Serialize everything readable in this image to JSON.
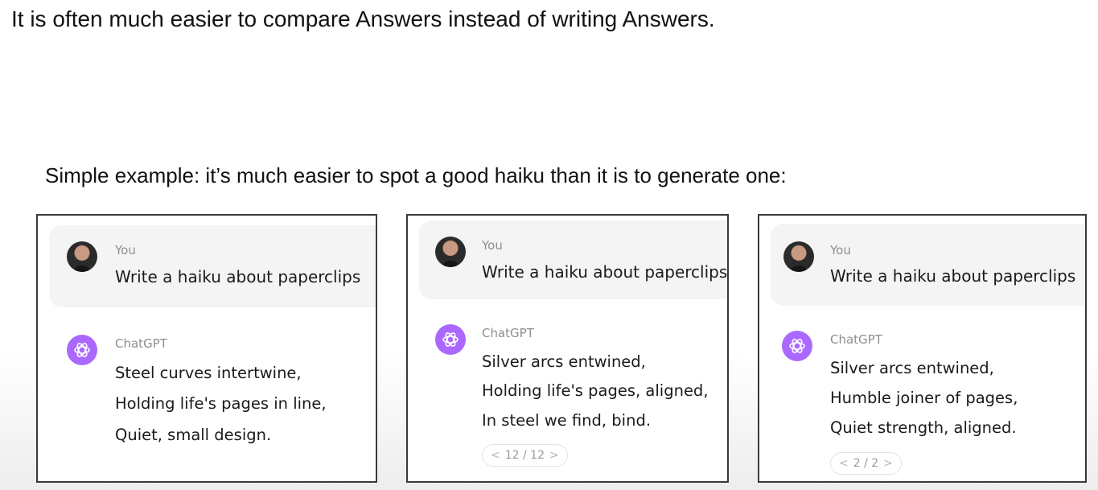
{
  "headline": "It is often much easier to compare Answers instead of writing Answers.",
  "subline": "Simple example: it’s much easier to spot a good haiku than it is to generate one:",
  "panels": [
    {
      "user_name": "You",
      "prompt": "Write a haiku about paperclips",
      "assistant_name": "ChatGPT",
      "lines": [
        "Steel curves intertwine,",
        "Holding life's pages in line,",
        "Quiet, small design."
      ]
    },
    {
      "user_name": "You",
      "prompt": "Write a haiku about paperclips",
      "assistant_name": "ChatGPT",
      "lines": [
        "Silver arcs entwined,",
        "Holding life's pages, aligned,",
        "In steel we find, bind."
      ],
      "pager": {
        "prev": "<",
        "label": "12 / 12",
        "next": ">"
      }
    },
    {
      "user_name": "You",
      "prompt": "Write a haiku about paperclips",
      "assistant_name": "ChatGPT",
      "lines": [
        "Silver arcs entwined,",
        "Humble joiner of pages,",
        "Quiet strength, aligned."
      ],
      "pager": {
        "prev": "<",
        "label": "2 / 2",
        "next": ">"
      }
    }
  ],
  "icons": {
    "user_avatar": "user-avatar-photo",
    "assistant": "openai-logo-icon"
  },
  "colors": {
    "assistant_logo": "#ab68ff",
    "user_block": "#f4f4f4"
  }
}
